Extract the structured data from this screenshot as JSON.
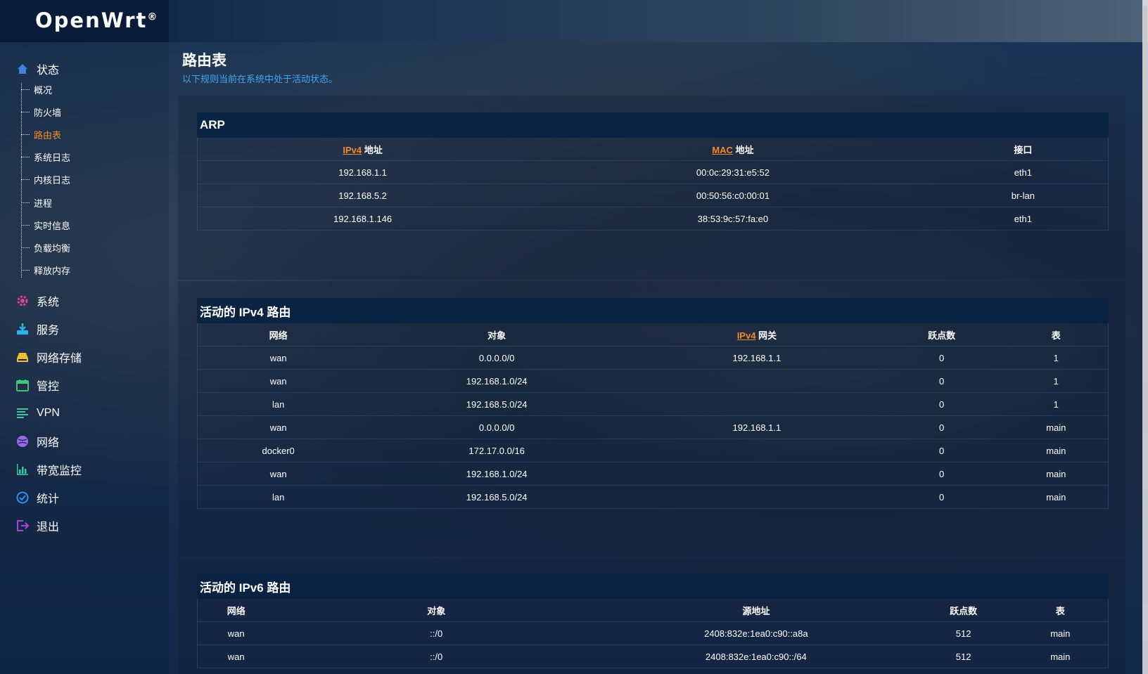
{
  "brand": {
    "name": "OpenWrt",
    "mark": "®"
  },
  "sidebar": {
    "status": {
      "label": "状态",
      "icon": "home-icon"
    },
    "sub_items": [
      {
        "label": "概况"
      },
      {
        "label": "防火墙"
      },
      {
        "label": "路由表",
        "active": true
      },
      {
        "label": "系统日志"
      },
      {
        "label": "内核日志"
      },
      {
        "label": "进程"
      },
      {
        "label": "实时信息"
      },
      {
        "label": "负载均衡"
      },
      {
        "label": "释放内存"
      }
    ],
    "items": [
      {
        "label": "系统",
        "icon": "gear-icon",
        "color": "#e0409a"
      },
      {
        "label": "服务",
        "icon": "download-icon",
        "color": "#2fb4e8"
      },
      {
        "label": "网络存储",
        "icon": "drive-icon",
        "color": "#f0c030"
      },
      {
        "label": "管控",
        "icon": "calendar-icon",
        "color": "#3fc47a"
      },
      {
        "label": "VPN",
        "icon": "lines-icon",
        "color": "#3fc4a0"
      },
      {
        "label": "网络",
        "icon": "globe-icon",
        "color": "#9a6cf0"
      },
      {
        "label": "带宽监控",
        "icon": "bar-chart-icon",
        "color": "#3fc4a0"
      },
      {
        "label": "统计",
        "icon": "clock-icon",
        "color": "#2f8ff0"
      },
      {
        "label": "退出",
        "icon": "logout-icon",
        "color": "#b040e0"
      }
    ]
  },
  "page": {
    "title": "路由表",
    "description": "以下规则当前在系统中处于活动状态。"
  },
  "arp": {
    "title": "ARP",
    "headers": {
      "ipv4_acr": "IPv4",
      "ipv4_rest": " 地址",
      "mac_acr": "MAC",
      "mac_rest": " 地址",
      "iface": "接口"
    },
    "rows": [
      [
        "192.168.1.1",
        "00:0c:29:31:e5:52",
        "eth1"
      ],
      [
        "192.168.5.2",
        "00:50:56:c0:00:01",
        "br-lan"
      ],
      [
        "192.168.1.146",
        "38:53:9c:57:fa:e0",
        "eth1"
      ]
    ]
  },
  "ipv4_routes": {
    "title": "活动的 IPv4 路由",
    "headers": {
      "network": "网络",
      "target": "对象",
      "gw_acr": "IPv4",
      "gw_rest": " 网关",
      "metric": "跃点数",
      "table": "表"
    },
    "rows": [
      [
        "wan",
        "0.0.0.0/0",
        "192.168.1.1",
        "0",
        "1"
      ],
      [
        "wan",
        "192.168.1.0/24",
        "",
        "0",
        "1"
      ],
      [
        "lan",
        "192.168.5.0/24",
        "",
        "0",
        "1"
      ],
      [
        "wan",
        "0.0.0.0/0",
        "192.168.1.1",
        "0",
        "main"
      ],
      [
        "docker0",
        "172.17.0.0/16",
        "",
        "0",
        "main"
      ],
      [
        "wan",
        "192.168.1.0/24",
        "",
        "0",
        "main"
      ],
      [
        "lan",
        "192.168.5.0/24",
        "",
        "0",
        "main"
      ]
    ]
  },
  "ipv6_routes": {
    "title": "活动的 IPv6 路由",
    "headers": {
      "network": "网络",
      "target": "对象",
      "source": "源地址",
      "metric": "跃点数",
      "table": "表"
    },
    "rows": [
      [
        "wan",
        "::/0",
        "2408:832e:1ea0:c90::a8a",
        "512",
        "main"
      ],
      [
        "wan",
        "::/0",
        "2408:832e:1ea0:c90::/64",
        "512",
        "main"
      ]
    ]
  }
}
